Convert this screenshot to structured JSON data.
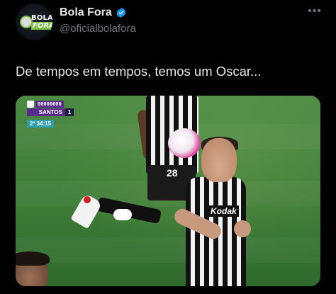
{
  "post": {
    "author": {
      "display_name": "Bola Fora",
      "handle": "@oficialbolafora",
      "verified": true,
      "avatar_logo_top": "BOLA",
      "avatar_logo_bottom": "FORA"
    },
    "more_icon": "more-horizontal-icon",
    "text": "De tempos em tempos, temos um Oscar...",
    "media": {
      "scoreboard": {
        "opponent_code": "00000000",
        "team": "SANTOS",
        "score": "1",
        "clock": "2º 34:15"
      },
      "player_number": "28",
      "sponsor": "Kodak"
    }
  },
  "colors": {
    "background": "#000000",
    "text_primary": "#e7e9ea",
    "text_secondary": "#71767b",
    "verified_blue": "#1d9bf0",
    "scoreboard_purple": "#5a2a8c",
    "clock_teal": "#2f9fb0"
  }
}
